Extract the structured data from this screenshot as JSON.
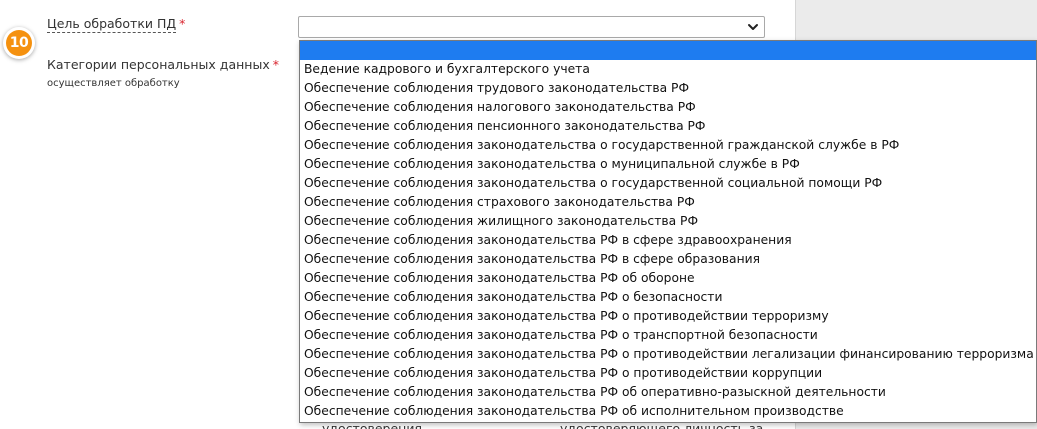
{
  "colors": {
    "badge": "#f5910f",
    "required": "#d9232d",
    "selected_option": "#1e7cf0",
    "side_panel": "#ebebeb"
  },
  "step_badge": {
    "number": "10"
  },
  "purpose_field": {
    "label": "Цель обработки ПД",
    "required_mark": "*",
    "selected_value": "",
    "arrow_icon": "chevron-down-icon"
  },
  "categories_field": {
    "label": "Категории персональных данных",
    "required_mark": "*",
    "hint": "осуществляет обработку"
  },
  "dropdown": {
    "options": [
      {
        "label": "",
        "selected": true
      },
      {
        "label": "Ведение кадрового и бухгалтерского учета"
      },
      {
        "label": "Обеспечение соблюдения трудового законодательства РФ"
      },
      {
        "label": "Обеспечение соблюдения налогового законодательства РФ"
      },
      {
        "label": "Обеспечение соблюдения пенсионного законодательства РФ"
      },
      {
        "label": "Обеспечение соблюдения законодательства о государственной гражданской службе в РФ"
      },
      {
        "label": "Обеспечение соблюдения законодательства о муниципальной службе в РФ"
      },
      {
        "label": "Обеспечение соблюдения законодательства о государственной социальной помощи РФ"
      },
      {
        "label": "Обеспечение соблюдения страхового законодательства РФ"
      },
      {
        "label": "Обеспечение соблюдения жилищного законодательства РФ"
      },
      {
        "label": "Обеспечение соблюдения законодательства РФ в сфере здравоохранения"
      },
      {
        "label": "Обеспечение соблюдения законодательства РФ в сфере образования"
      },
      {
        "label": "Обеспечение соблюдения законодательства РФ об обороне"
      },
      {
        "label": "Обеспечение соблюдения законодательства РФ о безопасности"
      },
      {
        "label": "Обеспечение соблюдения законодательства РФ о противодействии терроризму"
      },
      {
        "label": "Обеспечение соблюдения законодательства РФ о транспортной безопасности"
      },
      {
        "label": "Обеспечение соблюдения законодательства РФ о противодействии легализации финансированию терроризма"
      },
      {
        "label": "Обеспечение соблюдения законодательства РФ о противодействии коррупции"
      },
      {
        "label": "Обеспечение соблюдения законодательства РФ об оперативно-разыскной деятельности"
      },
      {
        "label": "Обеспечение соблюдения законодательства РФ об исполнительном производстве"
      }
    ]
  },
  "background_text": {
    "left": "удостоверения",
    "right": "удостоверяющего личность за"
  }
}
